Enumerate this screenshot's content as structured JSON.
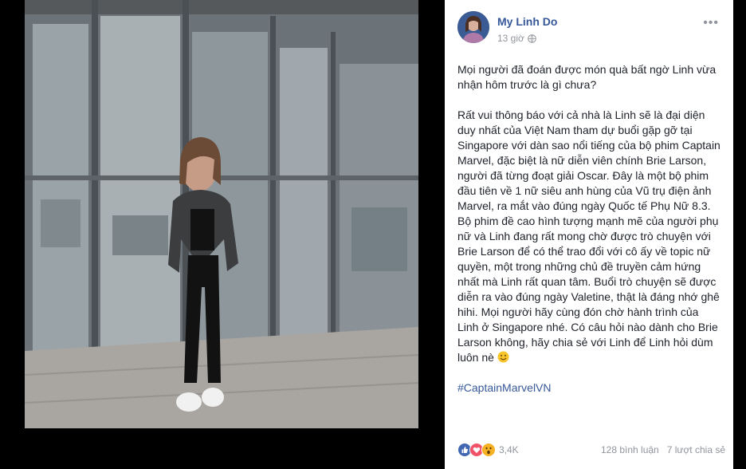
{
  "post": {
    "author": "My Linh Do",
    "time": "13 giờ",
    "more_icon": "ellipsis-icon",
    "paragraph_1": "Mọi người đã đoán được món quà bất ngờ Linh vừa nhận hôm trước là gì chưa?",
    "paragraph_2": "Rất vui thông báo với cả nhà là Linh sẽ là đại diện duy nhất của Việt Nam tham dự buổi gặp gỡ tại Singapore với dàn sao nổi tiếng của bộ phim Captain Marvel, đặc biệt là nữ diễn viên chính Brie Larson, người đã từng đoạt giải Oscar. Đây là một bộ phim đầu tiên về 1 nữ siêu anh hùng của Vũ trụ điện ảnh Marvel, ra mắt vào đúng ngày Quốc tế Phụ Nữ 8.3. Bộ phim đề cao hình tượng mạnh mẽ của người phụ nữ và Linh đang rất mong chờ được trò chuyện với Brie Larson để có thể trao đổi với cô ấy về topic nữ quyền, một trong những chủ đề truyền cảm hứng nhất mà Linh rất quan tâm. Buổi trò chuyện sẽ được diễn ra vào đúng ngày Valetine, thật là đáng nhớ ghê hihi. Mọi người hãy cùng đón chờ hành trình của Linh ở Singapore nhé. Có câu hỏi nào dành cho Brie Larson không, hãy chia sẻ với Linh để Linh hỏi dùm luôn nè",
    "hashtag": "#CaptainMarvelVN"
  },
  "footer": {
    "reaction_count": "3,4K",
    "comments": "128 bình luận",
    "shares": "7 lượt chia sẻ",
    "reaction_icons": [
      "like-icon",
      "love-icon",
      "wow-icon"
    ]
  },
  "colors": {
    "link": "#365899",
    "text": "#1d2129",
    "meta": "#90949c",
    "like": "#4267b2",
    "love": "#f25268",
    "wow": "#f7b125"
  }
}
